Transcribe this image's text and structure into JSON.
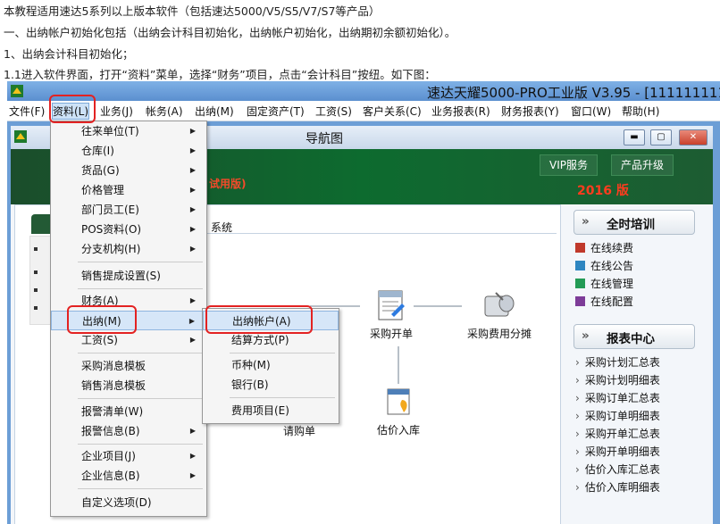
{
  "intro": [
    "本教程适用速达5系列以上版本软件（包括速达5000/V5/S5/V7/S7等产品）",
    "一、出纳帐户初始化包括（出纳会计科目初始化，出纳帐户初始化，出纳期初余额初始化）。",
    "1、出纳会计科目初始化；",
    "1.1进入软件界面，打开“资料”菜单，选择“财务”项目，点击“会计科目”按纽。如下图："
  ],
  "window": {
    "title": "速达天耀5000-PRO工业版 V3.95 - [111111111"
  },
  "menubar": [
    "文件(F)",
    "资料(L)",
    "业务(J)",
    "帐务(A)",
    "出纳(M)",
    "固定资产(T)",
    "工资(S)",
    "客户关系(C)",
    "业务报表(R)",
    "财务报表(Y)",
    "窗口(W)",
    "帮助(H)"
  ],
  "nav": {
    "title": "导航图",
    "vip_button": "VIP服务",
    "upgrade_button": "产品升级",
    "trial_text": "试用版)",
    "year_text": "2016 版",
    "tab_label": "系统",
    "process": [
      "采购开单",
      "采购费用分摊",
      "请购单",
      "估价入库"
    ]
  },
  "sidebar": {
    "training_title": "全时培训",
    "training_items": [
      "在线续费",
      "在线公告",
      "在线管理",
      "在线配置"
    ],
    "report_title": "报表中心",
    "report_items": [
      "采购计划汇总表",
      "采购计划明细表",
      "采购订单汇总表",
      "采购订单明细表",
      "采购开单汇总表",
      "采购开单明细表",
      "估价入库汇总表",
      "估价入库明细表"
    ]
  },
  "menu_data": [
    {
      "label": "往来单位(T)",
      "sub": true
    },
    {
      "label": "仓库(I)",
      "sub": true
    },
    {
      "label": "货品(G)",
      "sub": true
    },
    {
      "label": "价格管理",
      "sub": true
    },
    {
      "label": "部门员工(E)",
      "sub": true
    },
    {
      "label": "POS资料(O)",
      "sub": true
    },
    {
      "label": "分支机构(H)",
      "sub": true
    },
    {
      "label": "销售提成设置(S)",
      "sub": false
    },
    {
      "label": "财务(A)",
      "sub": true
    },
    {
      "label": "出纳(M)",
      "sub": true
    },
    {
      "label": "工资(S)",
      "sub": true
    },
    {
      "label": "采购消息模板",
      "sub": false
    },
    {
      "label": "销售消息模板",
      "sub": false
    },
    {
      "label": "报警清单(W)",
      "sub": false
    },
    {
      "label": "报警信息(B)",
      "sub": true
    },
    {
      "label": "企业项目(J)",
      "sub": true
    },
    {
      "label": "企业信息(B)",
      "sub": true
    },
    {
      "label": "自定义选项(D)",
      "sub": false
    }
  ],
  "submenu_cashier": [
    "出纳帐户(A)",
    "结算方式(P)",
    "币种(M)",
    "银行(B)",
    "费用项目(E)"
  ],
  "colors": {
    "accent": "#e32222",
    "banner": "#0d6b2f",
    "highlight": "#d6e6f8"
  }
}
